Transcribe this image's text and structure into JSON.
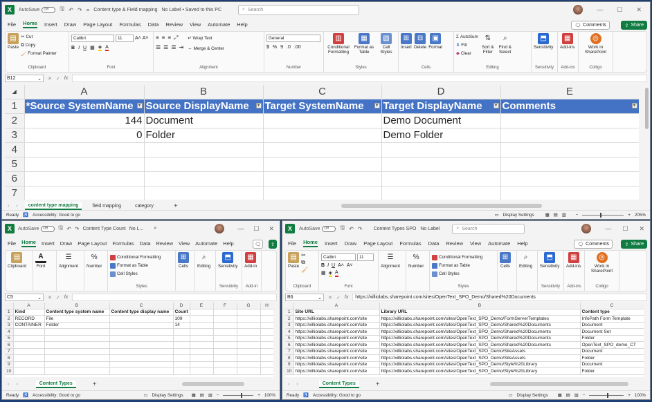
{
  "colors": {
    "excel_green": "#107c41",
    "header_blue": "#4472c4",
    "desktop": "#1e3f73"
  },
  "top": {
    "autosave_label": "AutoSave",
    "autosave_state": "Off",
    "title": "Content type & Field mapping",
    "label_info": "No Label • Saved to this PC",
    "search_placeholder": "Search",
    "menu": [
      "File",
      "Home",
      "Insert",
      "Draw",
      "Page Layout",
      "Formulas",
      "Data",
      "Review",
      "View",
      "Automate",
      "Help"
    ],
    "active_menu": "Home",
    "comments": "Comments",
    "share": "Share",
    "ribbon": {
      "paste": "Paste",
      "cut": "Cut",
      "copy": "Copy",
      "format_painter": "Format Painter",
      "clipboard": "Clipboard",
      "font_name": "Calibri",
      "font_size": "11",
      "font": "Font",
      "wrap_text": "Wrap Text",
      "merge_center": "Merge & Center",
      "alignment": "Alignment",
      "number_format": "General",
      "number": "Number",
      "conditional": "Conditional Formatting",
      "format_table": "Format as Table",
      "cell_styles": "Cell Styles",
      "styles": "Styles",
      "insert": "Insert",
      "delete": "Delete",
      "format": "Format",
      "cells": "Cells",
      "autosum": "AutoSum",
      "fill": "Fill",
      "clear": "Clear",
      "sort_filter": "Sort & Filter",
      "find_select": "Find & Select",
      "editing": "Editing",
      "sensitivity": "Sensitivity",
      "addins": "Add-ins",
      "work_sharepoint": "Work in SharePoint",
      "colligo": "Colligo"
    },
    "namebox": "B12",
    "formula": "",
    "columns": [
      "A",
      "B",
      "C",
      "D",
      "E"
    ],
    "rows": [
      {
        "n": "1",
        "cells": [
          "*Source SystemName",
          "Source DisplayName",
          "Target SystemName",
          "Target DisplayName",
          "Comments"
        ]
      },
      {
        "n": "2",
        "cells": [
          "144",
          "Document",
          "",
          "Demo Document",
          ""
        ]
      },
      {
        "n": "3",
        "cells": [
          "0",
          "Folder",
          "",
          "Demo Folder",
          ""
        ]
      },
      {
        "n": "4",
        "cells": [
          "",
          "",
          "",
          "",
          ""
        ]
      },
      {
        "n": "5",
        "cells": [
          "",
          "",
          "",
          "",
          ""
        ]
      },
      {
        "n": "6",
        "cells": [
          "",
          "",
          "",
          "",
          ""
        ]
      },
      {
        "n": "7",
        "cells": [
          "",
          "",
          "",
          "",
          ""
        ]
      }
    ],
    "sheets": [
      "content type mapping",
      "field mapping",
      "category"
    ],
    "status_ready": "Ready",
    "status_access": "Accessibility: Good to go",
    "display_settings": "Display Settings",
    "zoom": "205%"
  },
  "left": {
    "autosave_label": "AutoSave",
    "autosave_state": "Off",
    "title": "Content Type Count",
    "label_info": "No L...",
    "menu": [
      "File",
      "Home",
      "Insert",
      "Draw",
      "Page Layout",
      "Formulas",
      "Data",
      "Review",
      "View",
      "Automate",
      "Help"
    ],
    "ribbon": {
      "clipboard": "Clipboard",
      "font": "Font",
      "alignment": "Alignment",
      "number": "Number",
      "conditional": "Conditional Formatting",
      "format_table": "Format as Table",
      "cell_styles": "Cell Styles",
      "styles": "Styles",
      "cells": "Cells",
      "editing": "Editing",
      "sensitivity": "Sensitivity",
      "addins": "Add-in"
    },
    "namebox": "C5",
    "formula": "",
    "columns": [
      "A",
      "B",
      "C",
      "D",
      "E",
      "F",
      "G",
      "H"
    ],
    "rows": [
      {
        "n": "1",
        "cells": [
          "Kind",
          "Content type system name",
          "Content type display name",
          "Count",
          "",
          "",
          "",
          ""
        ]
      },
      {
        "n": "2",
        "cells": [
          "RECORD",
          "File",
          "",
          "109",
          "",
          "",
          "",
          ""
        ]
      },
      {
        "n": "3",
        "cells": [
          "CONTAINER",
          "Folder",
          "",
          "14",
          "",
          "",
          "",
          ""
        ]
      },
      {
        "n": "4",
        "cells": [
          "",
          "",
          "",
          "",
          "",
          "",
          "",
          ""
        ]
      },
      {
        "n": "5",
        "cells": [
          "",
          "",
          "",
          "",
          "",
          "",
          "",
          ""
        ]
      },
      {
        "n": "6",
        "cells": [
          "",
          "",
          "",
          "",
          "",
          "",
          "",
          ""
        ]
      },
      {
        "n": "7",
        "cells": [
          "",
          "",
          "",
          "",
          "",
          "",
          "",
          ""
        ]
      },
      {
        "n": "8",
        "cells": [
          "",
          "",
          "",
          "",
          "",
          "",
          "",
          ""
        ]
      },
      {
        "n": "9",
        "cells": [
          "",
          "",
          "",
          "",
          "",
          "",
          "",
          ""
        ]
      },
      {
        "n": "10",
        "cells": [
          "",
          "",
          "",
          "",
          "",
          "",
          "",
          ""
        ]
      }
    ],
    "sheets": [
      "Content Types"
    ],
    "status_ready": "Ready",
    "status_access": "Accessibility: Good to go",
    "display_settings": "Display Settings",
    "zoom": "100%"
  },
  "right": {
    "autosave_label": "AutoSave",
    "autosave_state": "Off",
    "title": "Content Types SPO",
    "label_info": "No Label",
    "search_placeholder": "Search",
    "menu": [
      "File",
      "Home",
      "Insert",
      "Draw",
      "Page Layout",
      "Formulas",
      "Data",
      "Review",
      "View",
      "Automate",
      "Help"
    ],
    "comments": "Comments",
    "share": "Share",
    "ribbon": {
      "paste": "Paste",
      "clipboard": "Clipboard",
      "font_name": "Calibri",
      "font_size": "11",
      "font": "Font",
      "alignment": "Alignment",
      "number": "Number",
      "conditional": "Conditional Formatting",
      "format_table": "Format as Table",
      "cell_styles": "Cell Styles",
      "styles": "Styles",
      "cells": "Cells",
      "editing": "Editing",
      "sensitivity": "Sensitivity",
      "addins": "Add-ins",
      "work_sharepoint": "Work in SharePoint",
      "colligo": "Colligo"
    },
    "namebox": "B6",
    "formula": "https://xilliolabs.sharepoint.com/sites/OpenText_SPO_Demo/Shared%20Documents",
    "columns": [
      "A",
      "B",
      "C"
    ],
    "rows": [
      {
        "n": "1",
        "cells": [
          "Site URL",
          "Library URL",
          "Content type"
        ]
      },
      {
        "n": "2",
        "cells": [
          "https://xilliolabs.sharepoint.com/site",
          "https://xilliolabs.sharepoint.com/sites/OpenText_SPO_Demo/FormServerTemplates",
          "InfoPath Form Template"
        ]
      },
      {
        "n": "3",
        "cells": [
          "https://xilliolabs.sharepoint.com/site",
          "https://xilliolabs.sharepoint.com/sites/OpenText_SPO_Demo/Shared%20Documents",
          "Document"
        ]
      },
      {
        "n": "4",
        "cells": [
          "https://xilliolabs.sharepoint.com/site",
          "https://xilliolabs.sharepoint.com/sites/OpenText_SPO_Demo/Shared%20Documents",
          "Document Set"
        ]
      },
      {
        "n": "5",
        "cells": [
          "https://xilliolabs.sharepoint.com/site",
          "https://xilliolabs.sharepoint.com/sites/OpenText_SPO_Demo/Shared%20Documents",
          "Folder"
        ]
      },
      {
        "n": "6",
        "cells": [
          "https://xilliolabs.sharepoint.com/site",
          "https://xilliolabs.sharepoint.com/sites/OpenText_SPO_Demo/Shared%20Documents",
          "OpenText_SPO_demo_CT"
        ]
      },
      {
        "n": "7",
        "cells": [
          "https://xilliolabs.sharepoint.com/site",
          "https://xilliolabs.sharepoint.com/sites/OpenText_SPO_Demo/SiteAssets",
          "Document"
        ]
      },
      {
        "n": "8",
        "cells": [
          "https://xilliolabs.sharepoint.com/site",
          "https://xilliolabs.sharepoint.com/sites/OpenText_SPO_Demo/SiteAssets",
          "Folder"
        ]
      },
      {
        "n": "9",
        "cells": [
          "https://xilliolabs.sharepoint.com/site",
          "https://xilliolabs.sharepoint.com/sites/OpenText_SPO_Demo/Style%20Library",
          "Document"
        ]
      },
      {
        "n": "10",
        "cells": [
          "https://xilliolabs.sharepoint.com/site",
          "https://xilliolabs.sharepoint.com/sites/OpenText_SPO_Demo/Style%20Library",
          "Folder"
        ]
      }
    ],
    "sheets": [
      "Content Types"
    ],
    "status_ready": "Ready",
    "status_access": "Accessibility: Good to go",
    "display_settings": "Display Settings",
    "zoom": "100%"
  }
}
